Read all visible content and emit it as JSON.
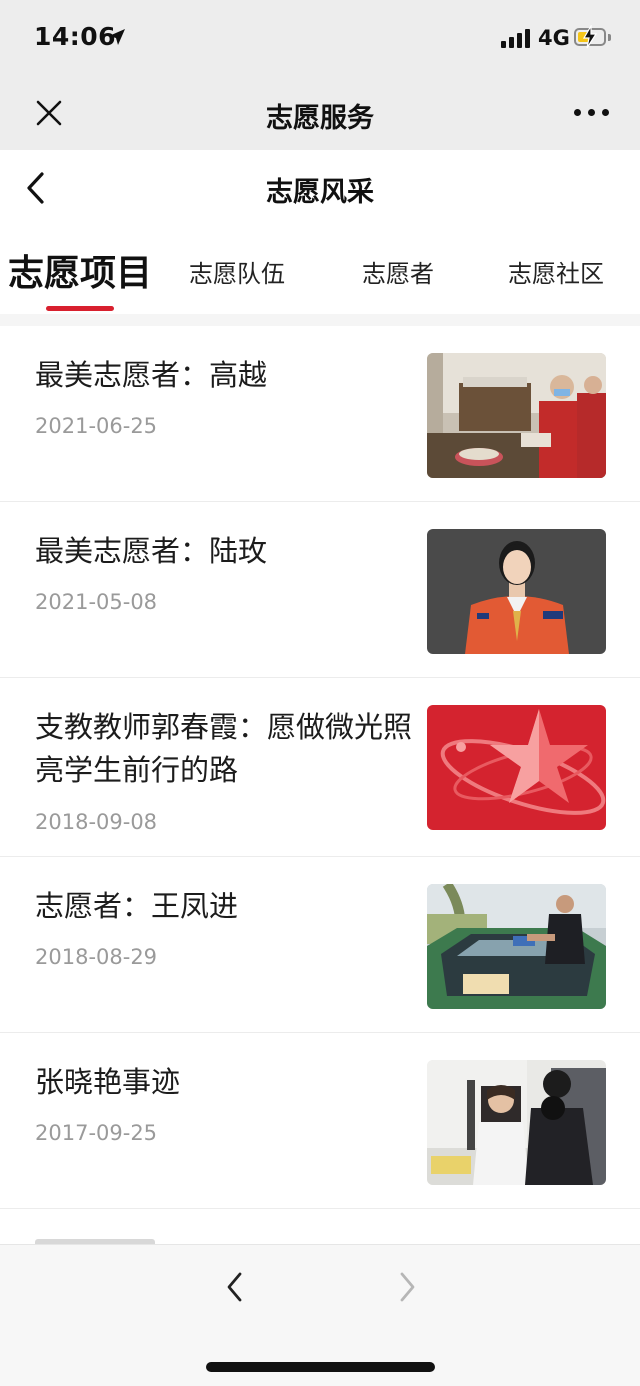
{
  "status_bar": {
    "time": "14:06",
    "network": "4G"
  },
  "nav": {
    "title": "志愿服务"
  },
  "header": {
    "title": "志愿风采"
  },
  "tabs": [
    {
      "label": "志愿项目",
      "active": true
    },
    {
      "label": "志愿队伍",
      "active": false
    },
    {
      "label": "志愿者",
      "active": false
    },
    {
      "label": "志愿社区",
      "active": false
    }
  ],
  "articles": [
    {
      "title": "最美志愿者：高越",
      "date": "2021-06-25",
      "thumbnail": "volunteers-in-red-vests-photo"
    },
    {
      "title": "最美志愿者：陆玫",
      "date": "2021-05-08",
      "thumbnail": "woman-in-orange-uniform-portrait"
    },
    {
      "title": "支教教师郭春霞：愿做微光照亮学生前行的路",
      "date": "2018-09-08",
      "thumbnail": "red-star-emblem"
    },
    {
      "title": "志愿者：王凤进",
      "date": "2018-08-29",
      "thumbnail": "man-cleaning-taxi-windshield"
    },
    {
      "title": "张晓艳事迹",
      "date": "2017-09-25",
      "thumbnail": "office-staff-with-visitors"
    }
  ],
  "colors": {
    "accent": "#d8202e",
    "bar_background": "#ededed",
    "date_text": "#9a9a9a",
    "battery_fill": "#f5c518"
  },
  "battery": {
    "level": 0.45,
    "charging": true
  },
  "icons": {
    "close": "close-icon",
    "more": "more-icon",
    "back": "chevron-left-icon",
    "forward": "chevron-right-icon"
  }
}
